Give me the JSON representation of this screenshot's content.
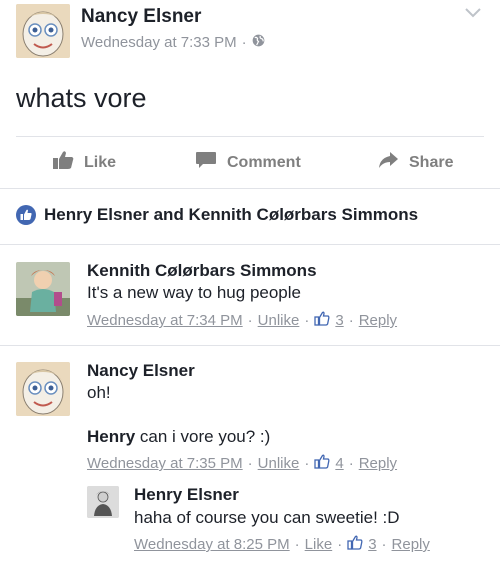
{
  "post": {
    "author": "Nancy Elsner",
    "time": "Wednesday at 7:33 PM",
    "separator": "·",
    "text": "whats vore"
  },
  "actions": {
    "like_label": "Like",
    "comment_label": "Comment",
    "share_label": "Share"
  },
  "reactions": {
    "names": "Henry Elsner and Kennith Cølørbars Simmons"
  },
  "comments": [
    {
      "author": "Kennith Cølørbars Simmons",
      "text": "It's a new way to hug people",
      "time": "Wednesday at 7:34 PM",
      "action": "Unlike",
      "likes": "3",
      "reply": "Reply"
    },
    {
      "author": "Nancy Elsner",
      "text": "oh!",
      "mention": "Henry",
      "text2": "can i vore you? :)",
      "time": "Wednesday at 7:35 PM",
      "action": "Unlike",
      "likes": "4",
      "reply": "Reply"
    }
  ],
  "reply": {
    "author": "Henry Elsner",
    "text": "haha of course you can sweetie! :D",
    "time": "Wednesday at 8:25 PM",
    "action": "Like",
    "likes": "3",
    "reply": "Reply"
  },
  "colors": {
    "accent": "#4267b2",
    "meta": "#90949c",
    "action_gray": "#7f7f7f"
  },
  "icons": {
    "globe": "globe-icon",
    "like": "thumbs-up-icon",
    "comment": "comment-icon",
    "share": "share-icon",
    "reaction": "like-reaction-icon",
    "chevron": "chevron-down-icon"
  }
}
